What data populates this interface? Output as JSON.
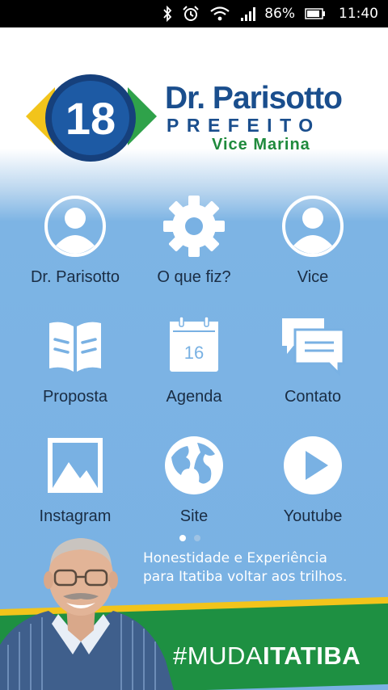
{
  "status_bar": {
    "battery": "86%",
    "time": "11:40",
    "icons": [
      "bluetooth-icon",
      "alarm-icon",
      "wifi-icon",
      "signal-icon",
      "battery-icon"
    ]
  },
  "logo": {
    "number": "18",
    "name": "Dr. Parisotto",
    "role": "PREFEITO",
    "vice": "Vice Marina"
  },
  "menu": [
    {
      "label": "Dr. Parisotto",
      "icon": "person-icon"
    },
    {
      "label": "O que fiz?",
      "icon": "gear-icon"
    },
    {
      "label": "Vice",
      "icon": "person-icon"
    },
    {
      "label": "Proposta",
      "icon": "book-icon"
    },
    {
      "label": "Agenda",
      "icon": "calendar-icon",
      "day": "16"
    },
    {
      "label": "Contato",
      "icon": "chat-icon"
    },
    {
      "label": "Instagram",
      "icon": "image-icon"
    },
    {
      "label": "Site",
      "icon": "globe-icon"
    },
    {
      "label": "Youtube",
      "icon": "play-icon"
    }
  ],
  "pager": {
    "current": 1,
    "total": 2
  },
  "slogan": {
    "line1": "Honestidade e Experiência",
    "line2": "para Itatiba voltar aos trilhos."
  },
  "hashtag": {
    "prefix": "#MUDA",
    "emphasis": "ITATIBA"
  },
  "colors": {
    "brand_blue": "#1a4e8d",
    "brand_green": "#1e9042",
    "brand_yellow": "#f2c41b",
    "background_blue": "#79b1e3"
  }
}
